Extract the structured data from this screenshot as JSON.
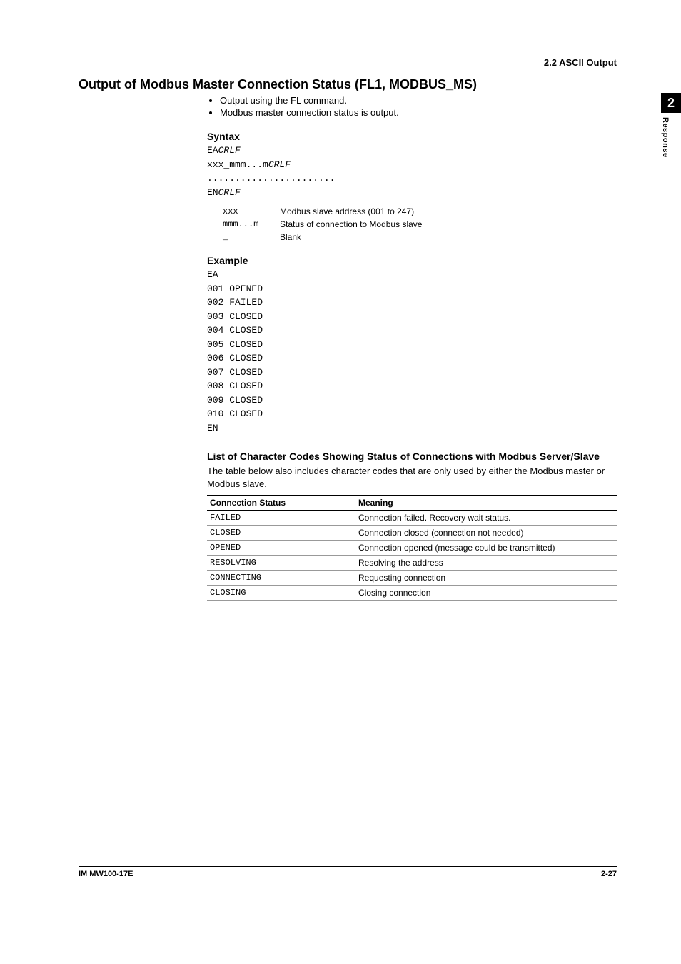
{
  "header": {
    "section_number": "2.2  ASCII Output"
  },
  "side_tab": {
    "chapter_number": "2",
    "chapter_label": "Response"
  },
  "title": "Output of Modbus Master Connection Status (FL1, MODBUS_MS)",
  "bullets": [
    "Output using the FL command.",
    "Modbus master connection status is output."
  ],
  "syntax": {
    "heading": "Syntax",
    "lines": [
      {
        "plain": "EA",
        "italic": "CRLF"
      },
      {
        "plain": "xxx_mmm...m",
        "italic": "CRLF"
      },
      {
        "plain": ".......................",
        "italic": ""
      },
      {
        "plain": "EN",
        "italic": "CRLF"
      }
    ],
    "params": [
      {
        "key": "xxx",
        "desc": "Modbus slave address (001 to 247)"
      },
      {
        "key": "mmm...m",
        "desc": "Status of connection to Modbus slave"
      },
      {
        "key": "_",
        "desc": "Blank"
      }
    ]
  },
  "example": {
    "heading": "Example",
    "lines": [
      "EA",
      "001 OPENED",
      "002 FAILED",
      "003 CLOSED",
      "004 CLOSED",
      "005 CLOSED",
      "006 CLOSED",
      "007 CLOSED",
      "008 CLOSED",
      "009 CLOSED",
      "010 CLOSED",
      "EN"
    ]
  },
  "codes_section": {
    "heading": "List of Character Codes Showing Status of Connections with Modbus Server/Slave",
    "intro": "The table below also includes character codes that are only used by either the Modbus master or Modbus slave.",
    "col1": "Connection Status",
    "col2": "Meaning",
    "rows": [
      {
        "code": "FAILED",
        "meaning": "Connection failed. Recovery wait status."
      },
      {
        "code": "CLOSED",
        "meaning": "Connection closed (connection not needed)"
      },
      {
        "code": "OPENED",
        "meaning": "Connection opened (message could be transmitted)"
      },
      {
        "code": "RESOLVING",
        "meaning": "Resolving the address"
      },
      {
        "code": "CONNECTING",
        "meaning": "Requesting connection"
      },
      {
        "code": "CLOSING",
        "meaning": "Closing connection"
      }
    ]
  },
  "footer": {
    "left": "IM MW100-17E",
    "right": "2-27"
  }
}
